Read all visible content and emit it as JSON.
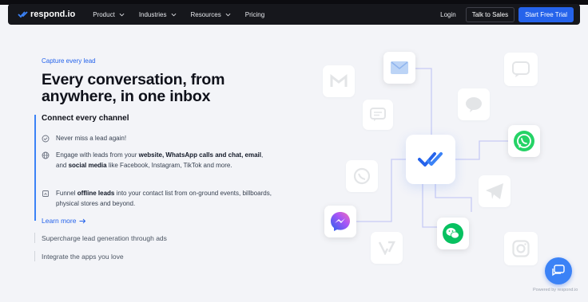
{
  "nav": {
    "brand": "respond.io",
    "items": [
      "Product",
      "Industries",
      "Resources"
    ],
    "pricing": "Pricing",
    "login": "Login",
    "talk": "Talk to Sales",
    "start": "Start Free Trial"
  },
  "hero": {
    "eyebrow": "Capture every lead",
    "headline": "Every conversation, from anywhere, in one inbox"
  },
  "accordion": {
    "open_title": "Connect every channel",
    "feature1": "Never miss a lead again!",
    "f2_a": "Engage with leads from your ",
    "f2_b": "website, WhatsApp calls and chat, email",
    "f2_c": ", and ",
    "f2_d": "social media",
    "f2_e": " like Facebook, Instagram, TikTok and more.",
    "f3_a": "Funnel ",
    "f3_b": "offline leads",
    "f3_c": " into your contact list from on-ground events, billboards, physical stores and beyond.",
    "learn_more": "Learn more",
    "item2": "Supercharge lead generation through ads",
    "item3": "Integrate the apps you love"
  },
  "channels": [
    "gmail-icon",
    "email-icon",
    "webchat-icon",
    "line-icon",
    "viber-icon",
    "messenger-icon",
    "vonage-icon",
    "wechat-icon",
    "telegram-icon",
    "instagram-icon",
    "sms-icon",
    "whatsapp-icon"
  ],
  "colors": {
    "accent": "#2563eb",
    "whatsapp": "#25d366",
    "wechat": "#07c160",
    "nav_bg": "#16171c"
  },
  "footer": {
    "powered": "Powered by respond.io"
  }
}
